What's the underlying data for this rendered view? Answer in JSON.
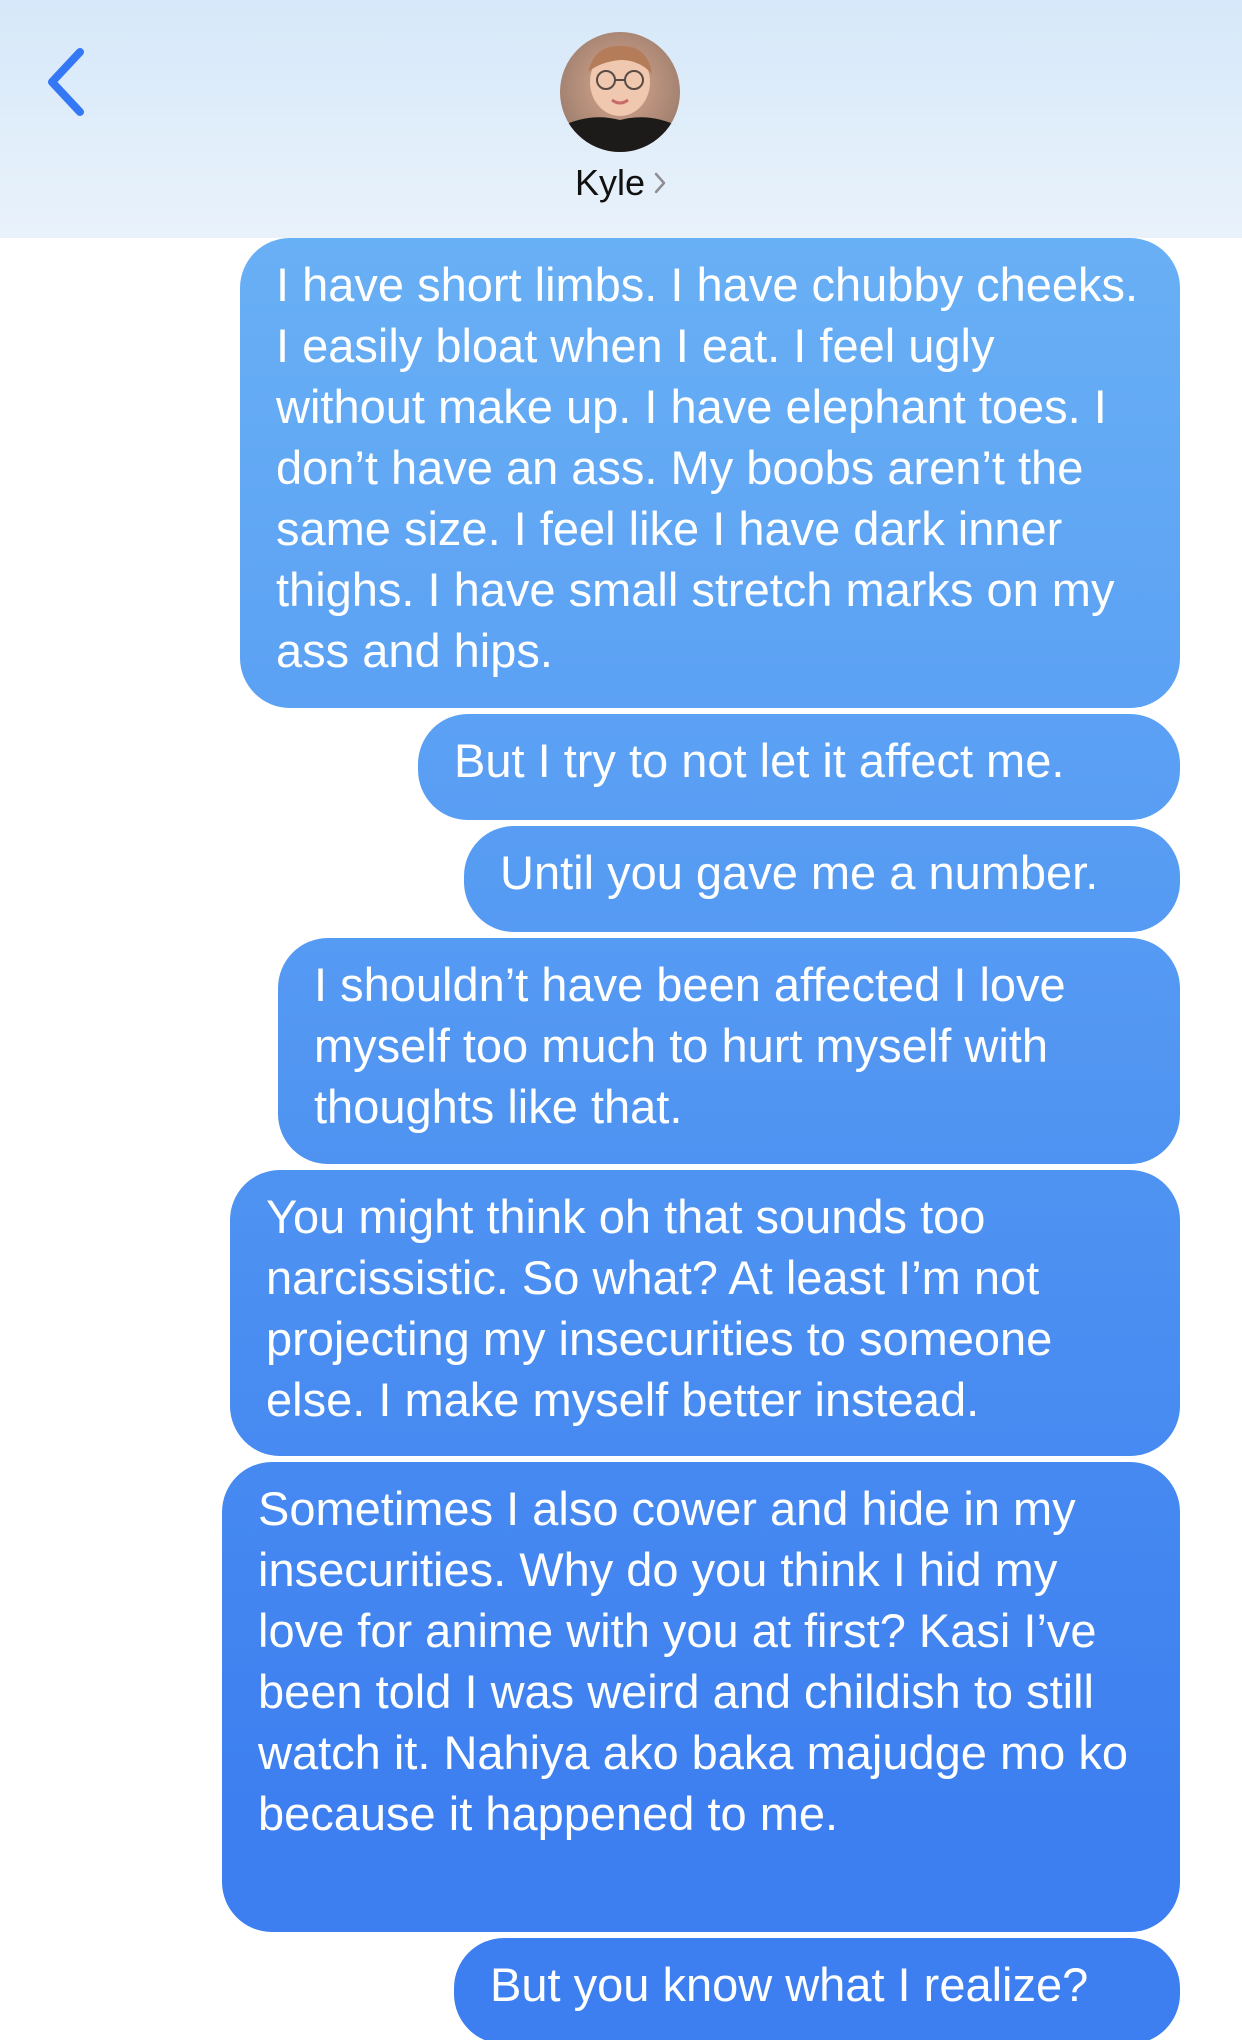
{
  "header": {
    "contact_name": "Kyle",
    "back_icon": "chevron-left-icon",
    "name_chevron_icon": "chevron-right-icon",
    "accent_color": "#3478f6"
  },
  "messages": [
    {
      "text": "I have short limbs. I have chubby cheeks. I easily bloat when I eat. I feel ugly without make up. I have elephant toes. I don’t have an ass. My boobs aren’t the same size. I feel like I have dark inner thighs. I have small stretch marks on my ass and hips."
    },
    {
      "text": "But I try to not let it affect me."
    },
    {
      "text": "Until you gave me a number."
    },
    {
      "text": "I shouldn’t have been affected I love myself too much to hurt myself with thoughts like that."
    },
    {
      "text": "You might think oh that sounds too narcissistic. So what? At least I’m not projecting my insecurities to someone else. I make myself better instead."
    },
    {
      "text": "Sometimes I also cower and hide in my insecurities. Why do you think I hid my love for anime with you at first? Kasi I’ve been told I was weird and childish to still watch it. Nahiya ako baka majudge mo ko because it happened to me."
    },
    {
      "text": "But you know what I realize?"
    }
  ]
}
